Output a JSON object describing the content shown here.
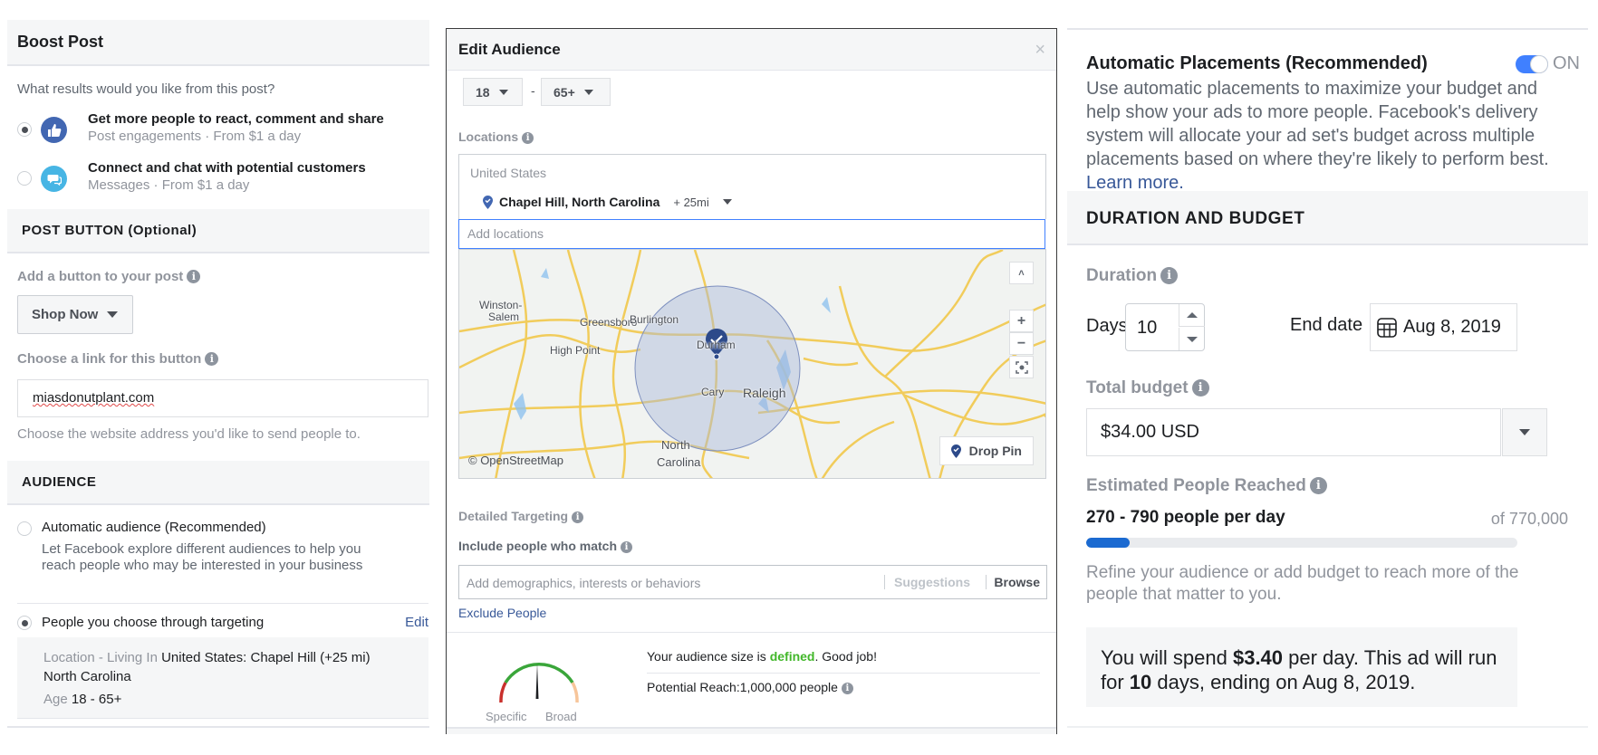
{
  "left_panel": {
    "title": "Boost Post",
    "question": "What results would you like from this post?",
    "objectives": [
      {
        "title": "Get more people to react, comment and share",
        "subtitle": "Post engagements · From $1 a day",
        "selected": true,
        "icon": "thumbs-up-icon",
        "color": "#4267b2"
      },
      {
        "title": "Connect and chat with potential customers",
        "subtitle": "Messages · From $1 a day",
        "selected": false,
        "icon": "messenger-icon",
        "color": "#47b5e4"
      }
    ],
    "post_button_section": "POST BUTTON (Optional)",
    "add_button_label": "Add a button to your post",
    "button_select_value": "Shop Now",
    "link_label": "Choose a link for this button",
    "link_value": "miasdonutplant.com",
    "link_hint": "Choose the website address you'd like to send people to.",
    "audience_section": "AUDIENCE",
    "audience_options": [
      {
        "label": "Automatic audience (Recommended)",
        "description_line1": "Let Facebook explore different audiences to help you",
        "description_line2": "reach people who may be interested in your business",
        "selected": false
      },
      {
        "label": "People you choose through targeting",
        "selected": true
      }
    ],
    "edit_label": "Edit",
    "summary": {
      "location_key": "Location - Living In",
      "location_value": "United States: Chapel Hill (+25 mi)",
      "location_value_line2": "North Carolina",
      "age_key": "Age",
      "age_value": "18 - 65+"
    }
  },
  "modal": {
    "title": "Edit Audience",
    "close": "×",
    "age_min": "18",
    "age_separator": "-",
    "age_max": "65+",
    "locations_label": "Locations",
    "location_country": "United States",
    "location_item": "Chapel Hill, North Carolina",
    "location_radius": "+ 25mi",
    "add_locations_placeholder": "Add locations",
    "map": {
      "cities": [
        "Winston-",
        "Salem",
        "Greensboro",
        "Burlington",
        "High Point",
        "Durham",
        "Cary",
        "Raleigh",
        "North",
        "Carolina"
      ],
      "attribution": "© OpenStreetMap",
      "drop_pin": "Drop Pin",
      "controls": {
        "collapse": "˄",
        "zoom_in": "+",
        "zoom_out": "−"
      }
    },
    "detailed_targeting_label": "Detailed Targeting",
    "include_label": "Include people who match",
    "include_placeholder": "Add demographics, interests or behaviors",
    "suggestions": "Suggestions",
    "browse": "Browse",
    "exclude_link": "Exclude People",
    "audience_size": {
      "prefix": "Your audience size is ",
      "status": "defined",
      "suffix": ". Good job!",
      "status_color": "#42b72a",
      "potential_reach": "Potential Reach:1,000,000 people",
      "gauge_left": "Specific",
      "gauge_right": "Broad",
      "gauge_position": 0.5
    }
  },
  "right_panel": {
    "placements_title": "Automatic Placements (Recommended)",
    "placements_toggle": "ON",
    "placements_on": true,
    "placements_desc": "Use automatic placements to maximize your budget and help show your ads to more people. Facebook's delivery system will allocate your ad set's budget across multiple placements based on where they're likely to perform best. ",
    "learn_more": "Learn more.",
    "section": "DURATION AND BUDGET",
    "duration_label": "Duration",
    "days_label": "Days",
    "days_value": "10",
    "end_date_label": "End date",
    "end_date_value": "Aug 8, 2019",
    "budget_label": "Total budget",
    "budget_value": "$34.00 USD",
    "reach_label": "Estimated People Reached",
    "reach_range": "270 - 790 people per day",
    "reach_total": "of 770,000",
    "reach_progress": 0.1,
    "reach_hint": "Refine your audience or add budget to reach more of the people that matter to you.",
    "spend": {
      "p1": "You will spend ",
      "amount": "$3.40",
      "p2": " per day. This ad will run for ",
      "days": "10",
      "p3": " days, ending on Aug 8, 2019."
    }
  }
}
